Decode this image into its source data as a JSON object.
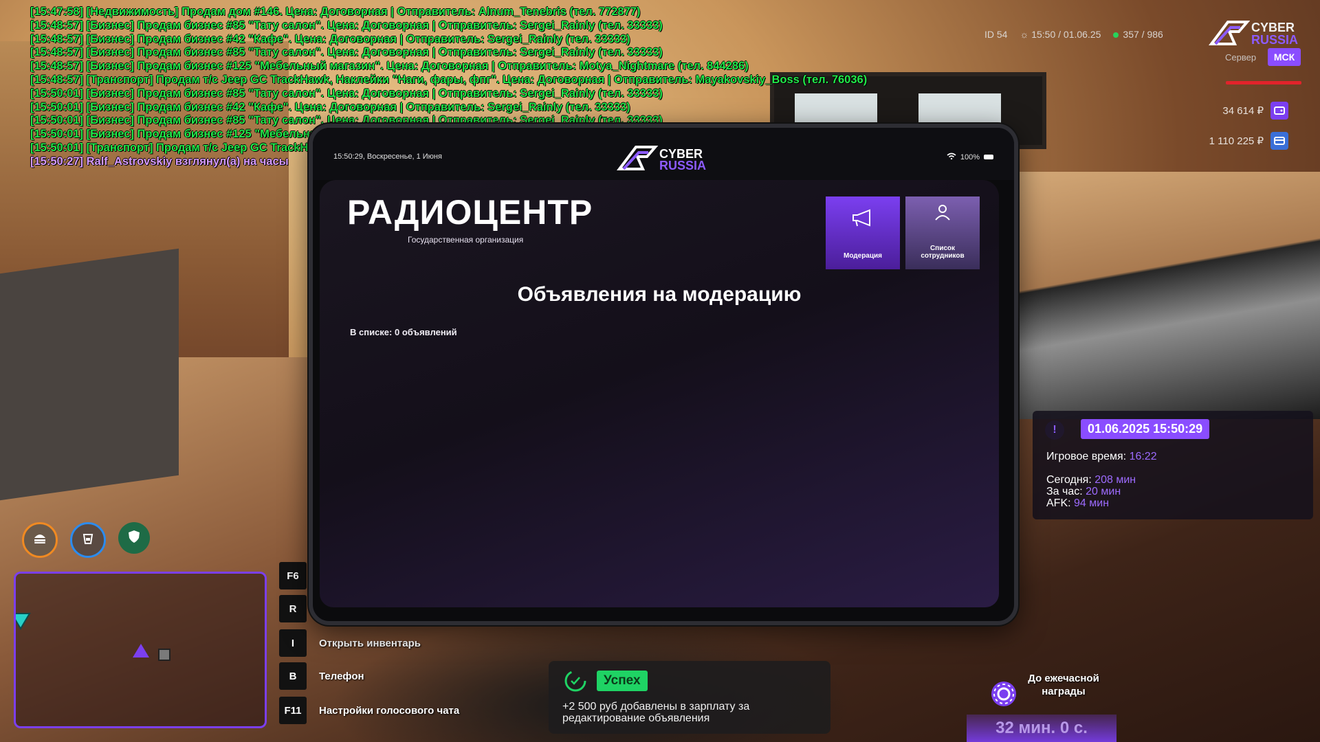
{
  "chat": {
    "lines": [
      "[15:47:58] [Недвижимость] Продам дом #146. Цена: Договорная | Отправитель: Alnum_Tenebris (тел. 772877)",
      "[15:48:57] [Бизнес] Продам бизнес #85 \"Тату салон\". Цена: Договорная | Отправитель: Sergei_Rainly (тел. 33333)",
      "[15:48:57] [Бизнес] Продам бизнес #42 \"Кафе\". Цена: Договорная | Отправитель: Sergei_Rainly (тел. 33333)",
      "[15:48:57] [Бизнес] Продам бизнес #85 \"Тату салон\". Цена: Договорная | Отправитель: Sergei_Rainly (тел. 33333)",
      "[15:48:57] [Бизнес] Продам бизнес #125 \"Мебельный магазин\". Цена: Договорная | Отправитель: Motya_Nightmare (тел. 844286)",
      "[15:48:57] [Транспорт] Продам т/с Jeep GC TrackHawk, Наклейки \"Наги, фары, фпг\". Цена: Договорная | Отправитель: Mayakovskiy_Boss (тел. 76036)",
      "[15:50:01] [Бизнес] Продам бизнес #85 \"Тату салон\". Цена: Договорная | Отправитель: Sergei_Rainly (тел. 33333)",
      "[15:50:01] [Бизнес] Продам бизнес #42 \"Кафе\". Цена: Договорная | Отправитель: Sergei_Rainly (тел. 33333)",
      "[15:50:01] [Бизнес] Продам бизнес #85 \"Тату салон\". Цена: Договорная | Отправитель: Sergei_Rainly (тел. 33333)",
      "[15:50:01] [Бизнес] Продам бизнес #125 \"Мебельный магазин\"",
      "[15:50:01] [Транспорт] Продам т/с Jeep GC TrackHawk"
    ],
    "highlight_line": "[15:50:27] Ralf_Astrovskiy взглянул(а) на часы"
  },
  "hud": {
    "id_label": "ID",
    "id_value": "54",
    "time": "15:50",
    "date": "01.06.25",
    "online": "357",
    "online_max": "986",
    "logo_line1": "CYBER",
    "logo_line2": "RUSSIA",
    "server_label": "Сервер",
    "server_badge": "МСК",
    "money_cash": "34 614 ₽",
    "money_bank": "1 110 225 ₽",
    "colors": {
      "accent": "#8a4dff",
      "health": "#e2232b",
      "chat": "#22e84a",
      "chat_highlight": "#d79bff"
    }
  },
  "tablet": {
    "status_time": "15:50:29, Воскресенье, 1 Июня",
    "wifi_battery": "100%",
    "logo_line1": "CYBER",
    "logo_line2": "RUSSIA",
    "org_title": "РАДИОЦЕНТР",
    "org_subtitle": "Государственная организация",
    "menu": [
      {
        "label": "Модерация",
        "icon": "megaphone-icon",
        "active": true
      },
      {
        "label": "Список сотрудников",
        "icon": "user-icon",
        "active": false
      }
    ],
    "list_title": "Объявления на модерацию",
    "list_count": "В списке: 0 объявлений"
  },
  "stats": {
    "warn": "!",
    "datetime": "01.06.2025 15:50:29",
    "game_time_label": "Игровое время:",
    "game_time_value": "16:22",
    "today_label": "Сегодня:",
    "today_value": "208 мин",
    "hour_label": "За час:",
    "hour_value": "20 мин",
    "afk_label": "AFK:",
    "afk_value": "94 мин"
  },
  "keys": [
    {
      "key": "F6",
      "label": ""
    },
    {
      "key": "R",
      "label": ""
    },
    {
      "key": "I",
      "label": "Открыть инвентарь"
    },
    {
      "key": "B",
      "label": "Телефон"
    },
    {
      "key": "F11",
      "label": "Настройки голосового чата"
    }
  ],
  "notification": {
    "badge": "Успех",
    "message": "+2 500 руб добавлены в зарплату за редактирование объявления"
  },
  "reward": {
    "label": "До ежечасной награды",
    "timer": "32 мин. 0 с."
  }
}
